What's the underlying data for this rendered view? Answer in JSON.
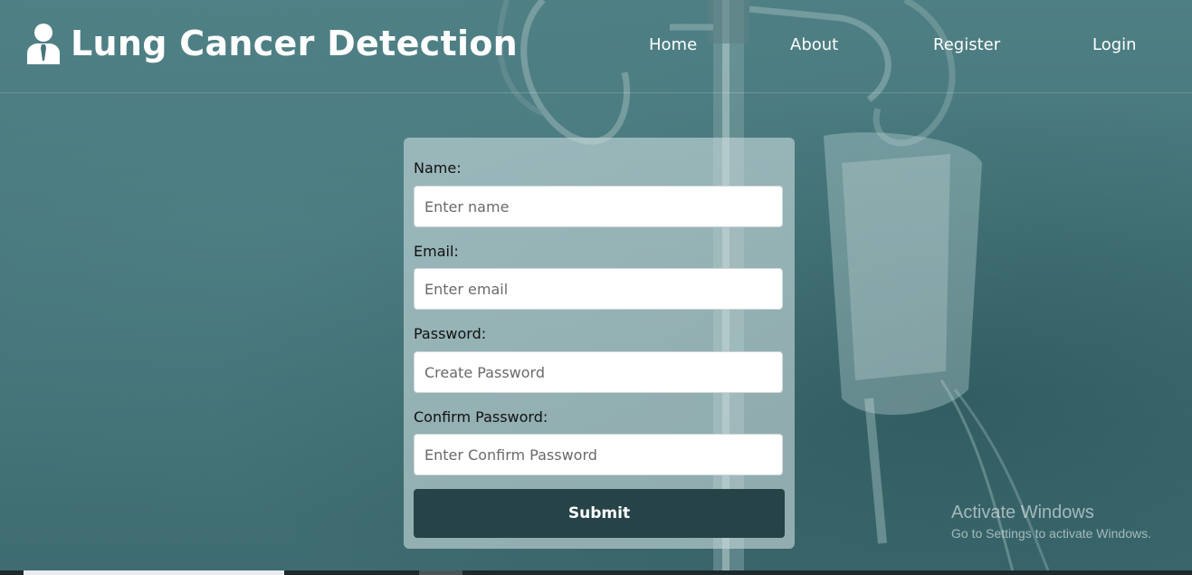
{
  "header": {
    "brand_title": "Lung Cancer Detection",
    "brand_icon": "user-tie-icon",
    "nav": {
      "home": "Home",
      "about": "About",
      "register": "Register",
      "login": "Login"
    }
  },
  "form": {
    "name_label": "Name:",
    "name_placeholder": "Enter name",
    "email_label": "Email:",
    "email_placeholder": "Enter email",
    "password_label": "Password:",
    "password_placeholder": "Create Password",
    "confirm_label": "Confirm Password:",
    "confirm_placeholder": "Enter Confirm Password",
    "submit_label": "Submit"
  },
  "watermark": {
    "title": "Activate Windows",
    "subtitle": "Go to Settings to activate Windows."
  },
  "colors": {
    "background": "#45757a",
    "button": "#264347",
    "card": "#c8dadc"
  }
}
